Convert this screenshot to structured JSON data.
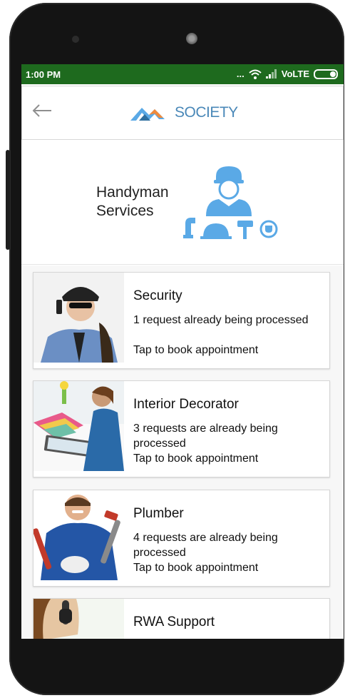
{
  "status": {
    "time": "1:00 PM",
    "dots": "...",
    "network": "VoLTE"
  },
  "appbar": {
    "logo_text": "SOCIETY"
  },
  "hero": {
    "title_line1": "Handyman",
    "title_line2": "Services"
  },
  "services": [
    {
      "title": "Security",
      "status": "1 request already being processed",
      "cta": "Tap to book appointment"
    },
    {
      "title": "Interior Decorator",
      "status": "3 requests are already being processed",
      "cta": "Tap to book appointment"
    },
    {
      "title": "Plumber",
      "status": "4 requests are already being processed",
      "cta": "Tap to book appointment"
    },
    {
      "title": "RWA Support"
    }
  ],
  "colors": {
    "statusbar": "#1e6a1e",
    "accent": "#5aa9e6",
    "logo_blue": "#4a88b8",
    "logo_orange": "#f08a3c"
  }
}
